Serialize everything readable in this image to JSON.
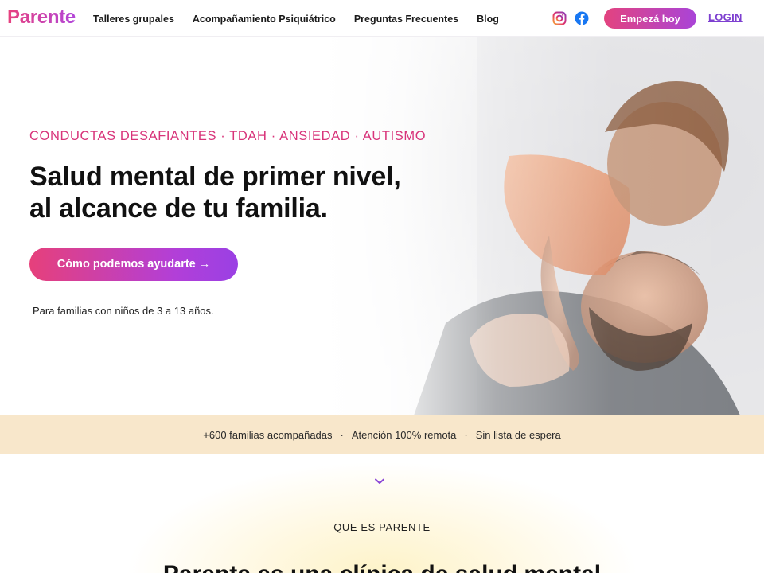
{
  "header": {
    "logo": "Parente",
    "nav": [
      "Talleres grupales",
      "Acompañamiento Psiquiátrico",
      "Preguntas Frecuentes",
      "Blog"
    ],
    "social": [
      "instagram-icon",
      "facebook-icon"
    ],
    "cta": "Empezá hoy",
    "login": "LOGIN"
  },
  "hero": {
    "eyebrow": "CONDUCTAS DESAFIANTES · TDAH · ANSIEDAD · AUTISMO",
    "headline_line1": "Salud mental de primer nivel,",
    "headline_line2": "al alcance de tu familia.",
    "cta": "Cómo podemos ayudarte →",
    "note": "Para familias con niños de 3 a 13 años."
  },
  "strip": {
    "items": [
      "+600 familias acompañadas",
      "Atención 100% remota",
      "Sin lista de espera"
    ],
    "separator": "·"
  },
  "section": {
    "label": "QUE ES PARENTE",
    "title": "Parente es una clínica de salud mental"
  },
  "colors": {
    "brand_pink": "#e3437f",
    "brand_purple": "#a944d8",
    "strip_bg": "#f8e7cb"
  }
}
